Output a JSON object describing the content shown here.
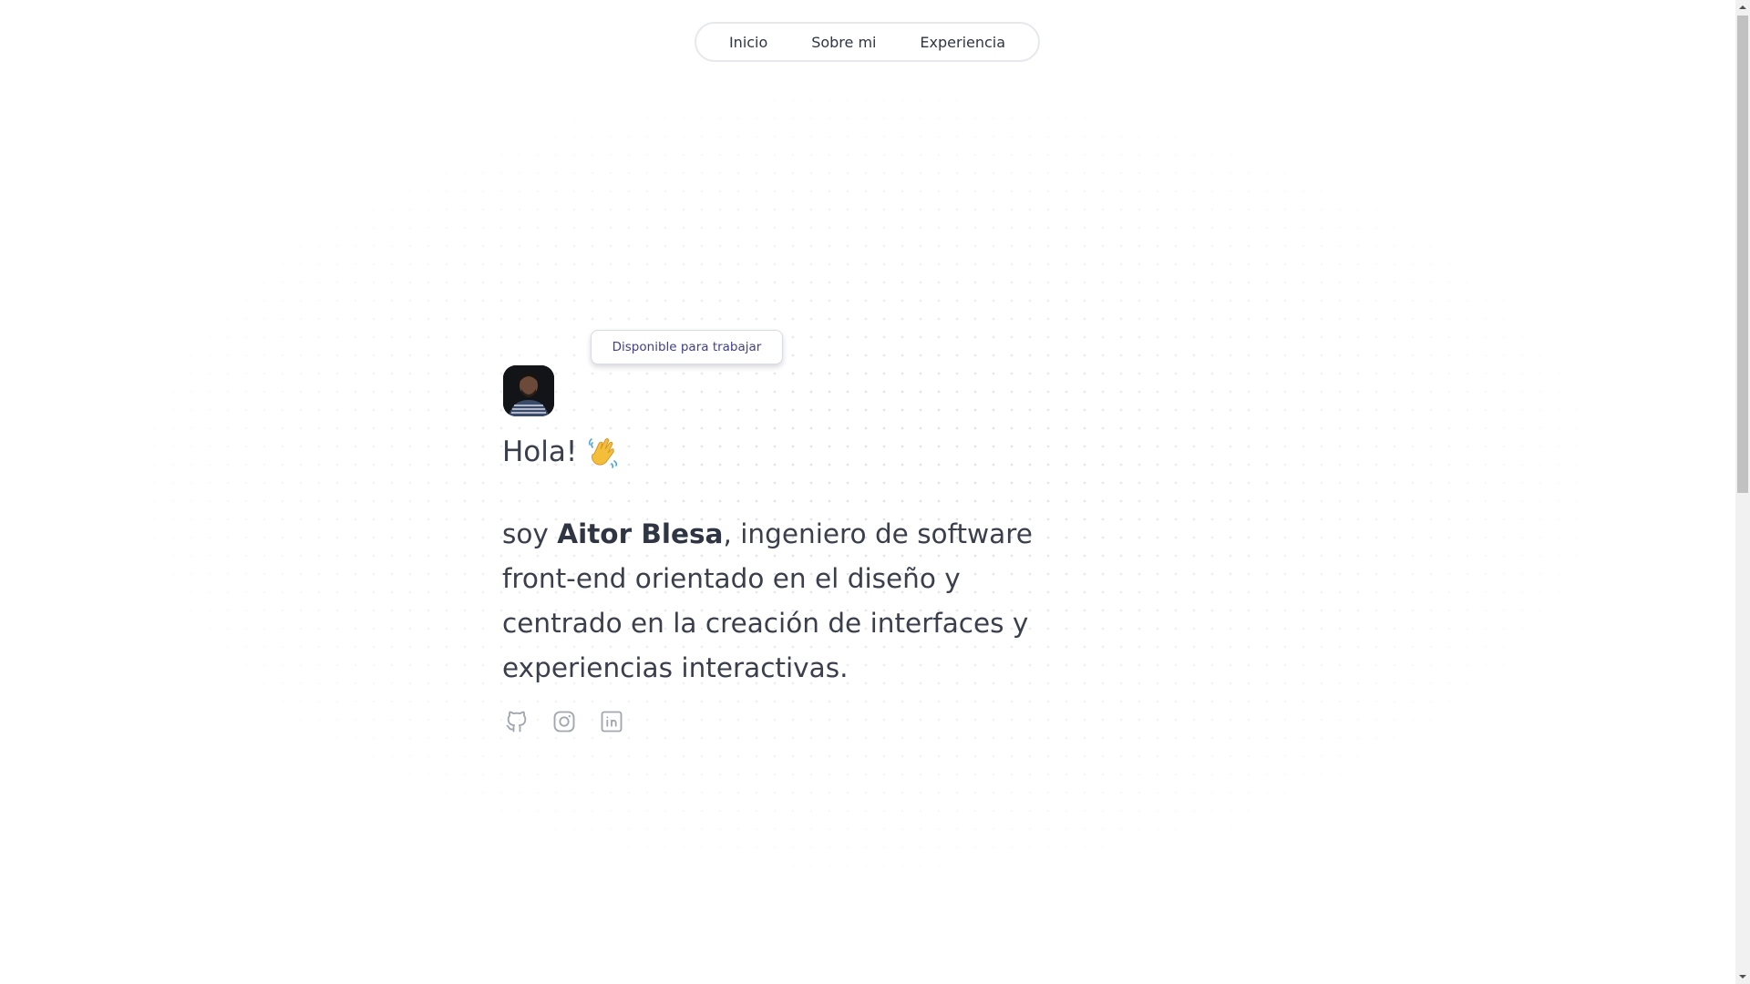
{
  "nav": {
    "items": [
      {
        "label": "Inicio"
      },
      {
        "label": "Sobre mi"
      },
      {
        "label": "Experiencia"
      }
    ]
  },
  "hero": {
    "badge": "Disponible para trabajar",
    "greeting": "Hola!",
    "greeting_emoji": "waving-hand",
    "intro_prefix": "soy ",
    "name": "Aitor Blesa",
    "intro_suffix": ", ingeniero de software front-end orientado en el diseño y centrado en la creación de interfaces y experiencias interactivas."
  },
  "socials": [
    {
      "icon": "github-icon"
    },
    {
      "icon": "instagram-icon"
    },
    {
      "icon": "linkedin-icon"
    }
  ],
  "colors": {
    "text": "#3a3f4b",
    "badge_text": "#3f3f8f",
    "icon": "#9aa0aa",
    "border": "#e6e8ec"
  }
}
